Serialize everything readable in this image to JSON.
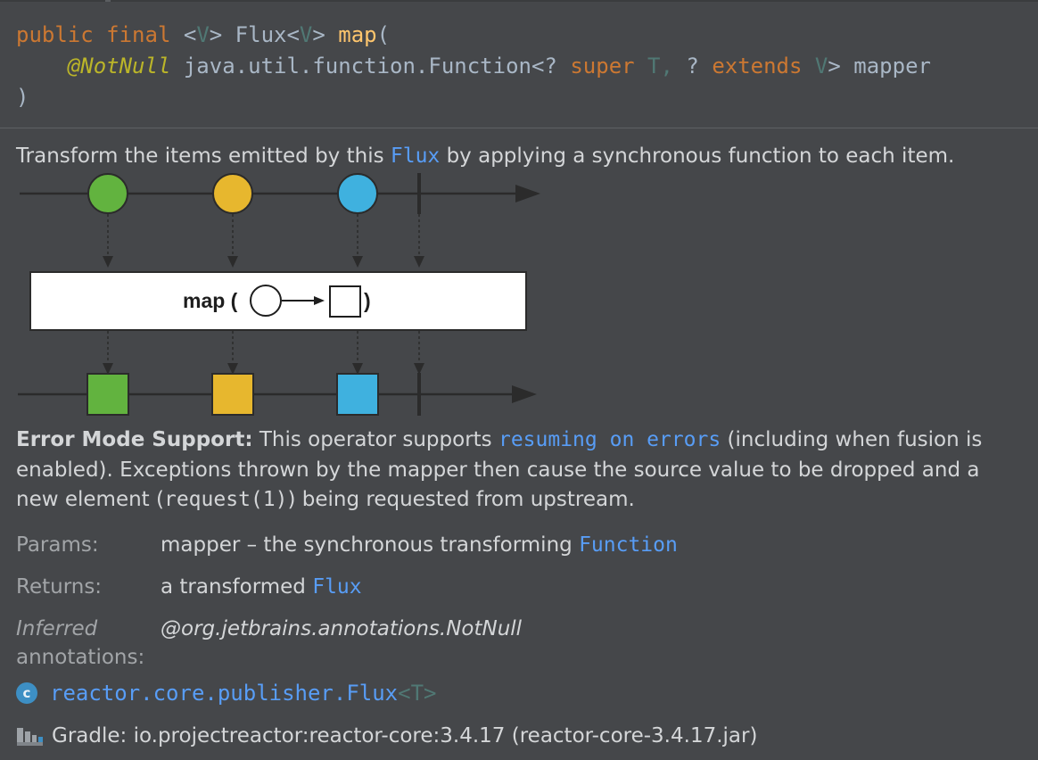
{
  "signature": {
    "kw_public": "public",
    "kw_final": "final",
    "lt1": "<",
    "type_v": "V",
    "gt1": ">",
    "return_type": "Flux",
    "lt2": "<",
    "type_v2": "V",
    "gt2": ">",
    "method": "map",
    "open_paren": "(",
    "annotation": "@NotNull",
    "param_type": "java.util.function.Function",
    "generic_open": "<?",
    "kw_super": "super",
    "type_t": "T,",
    "wildcard": "?",
    "kw_extends": "extends",
    "type_v3": "V",
    "generic_close": ">",
    "param_name": "mapper",
    "close_paren": ")"
  },
  "description": {
    "before": "Transform the items emitted by this ",
    "link": "Flux",
    "after": " by applying a synchronous function to each item."
  },
  "diagram": {
    "operator_label": "map (",
    "operator_close": ")",
    "colors": {
      "green": "#62b33f",
      "yellow": "#e7b72e",
      "blue": "#3fb1df",
      "line": "#2b2b2b"
    }
  },
  "error_mode": {
    "heading": "Error Mode Support:",
    "text1": " This operator supports ",
    "link": "resuming on errors",
    "text2": " (including when fusion is enabled). Exceptions thrown by the mapper then cause the source value to be dropped and a new element (",
    "code": "request(1)",
    "text3": ") being requested from upstream."
  },
  "params": {
    "label": "Params:",
    "name": "mapper",
    "dash_text": " – the synchronous transforming ",
    "link": "Function"
  },
  "returns": {
    "label": "Returns:",
    "text": "a transformed ",
    "link": "Flux"
  },
  "inferred": {
    "label_line1": "Inferred",
    "label_line2": "annotations:",
    "value": "@org.jetbrains.annotations.NotNull"
  },
  "class_ref": {
    "icon": "class-icon",
    "icon_letter": "c",
    "name": "reactor.core.publisher.Flux",
    "generic": "<T>"
  },
  "library": {
    "icon": "library-icon",
    "text": "Gradle: io.projectreactor:reactor-core:3.4.17 (reactor-core-3.4.17.jar)"
  }
}
